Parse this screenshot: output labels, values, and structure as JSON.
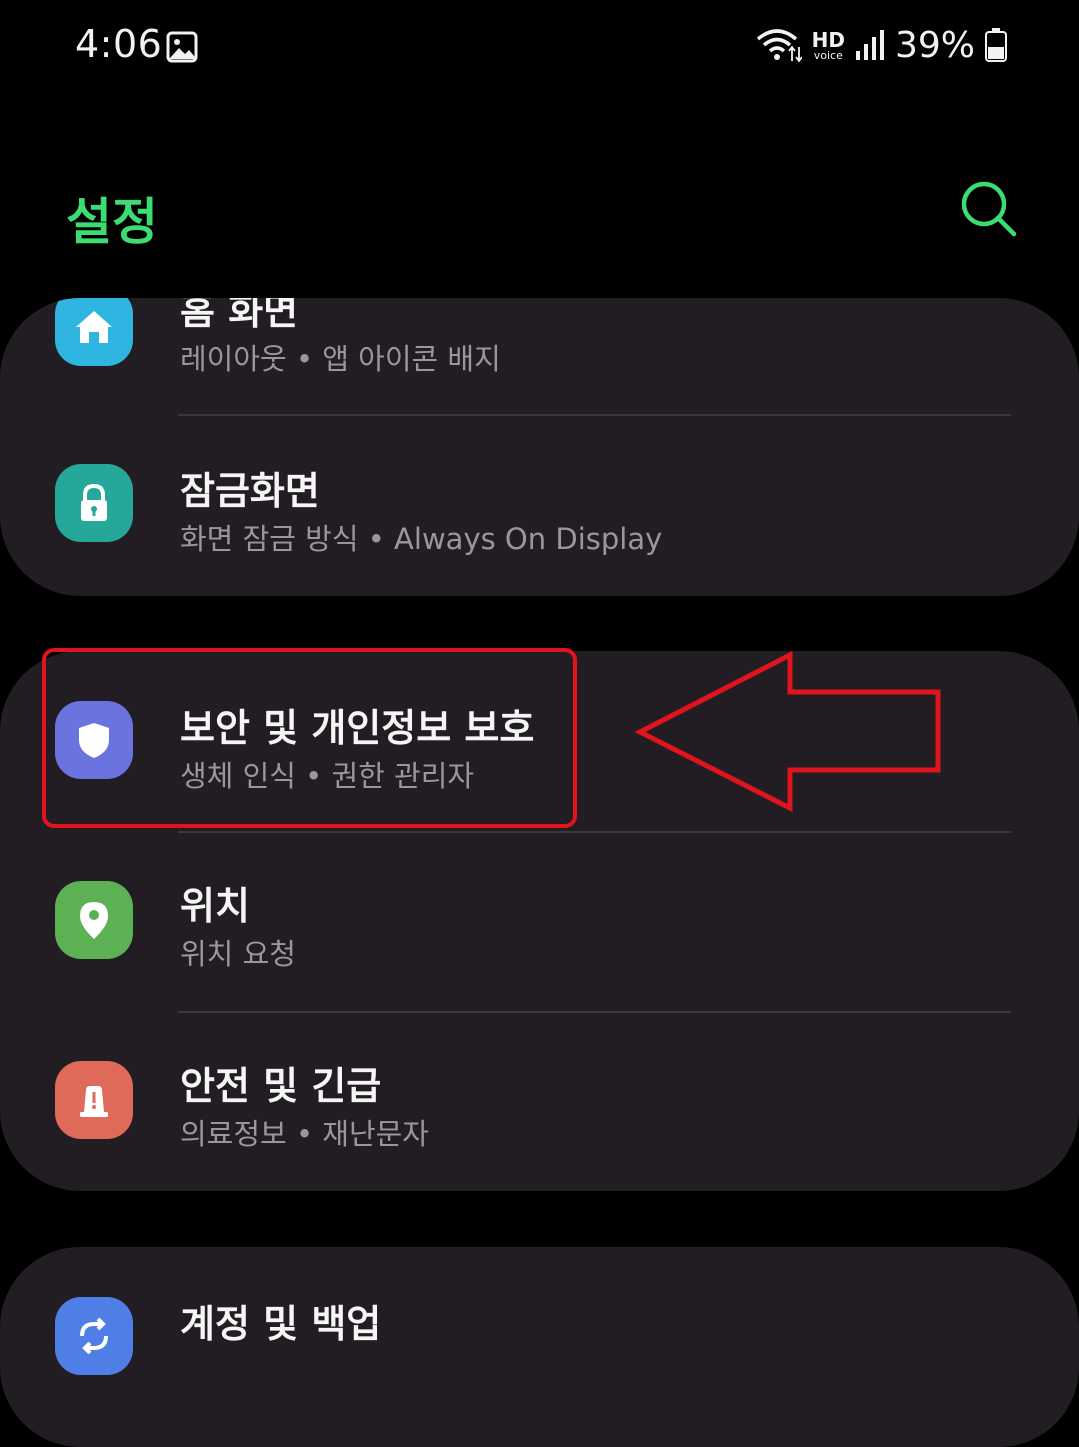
{
  "status_bar": {
    "time": "4:06",
    "battery_percent": "39%",
    "hd_voice": "HD",
    "voice_label": "voice",
    "icons": [
      "gallery-icon",
      "wifi-icon",
      "hd-voice-icon",
      "signal-icon",
      "battery-icon"
    ]
  },
  "header": {
    "title": "설정",
    "search_icon": "search-icon"
  },
  "colors": {
    "accent": "#3ddc72",
    "card_bg": "#221d22",
    "highlight": "#e0141d"
  },
  "items": [
    {
      "title": "홈 화면",
      "subtitle": "레이아웃  •  앱 아이콘 배지",
      "icon": "home-icon",
      "icon_color": "#2fb6e0"
    },
    {
      "title": "잠금화면",
      "subtitle": "화면 잠금 방식  •  Always On Display",
      "icon": "lock-icon",
      "icon_color": "#25a899"
    },
    {
      "title": "보안 및 개인정보 보호",
      "subtitle": "생체 인식  •  권한 관리자",
      "icon": "shield-icon",
      "icon_color": "#6a73de"
    },
    {
      "title": "위치",
      "subtitle": "위치 요청",
      "icon": "location-pin-icon",
      "icon_color": "#5bb154"
    },
    {
      "title": "안전 및 긴급",
      "subtitle": "의료정보  •  재난문자",
      "icon": "emergency-icon",
      "icon_color": "#e06a5a"
    },
    {
      "title": "계정 및 백업",
      "subtitle": "",
      "icon": "sync-icon",
      "icon_color": "#4f7fe6"
    }
  ]
}
